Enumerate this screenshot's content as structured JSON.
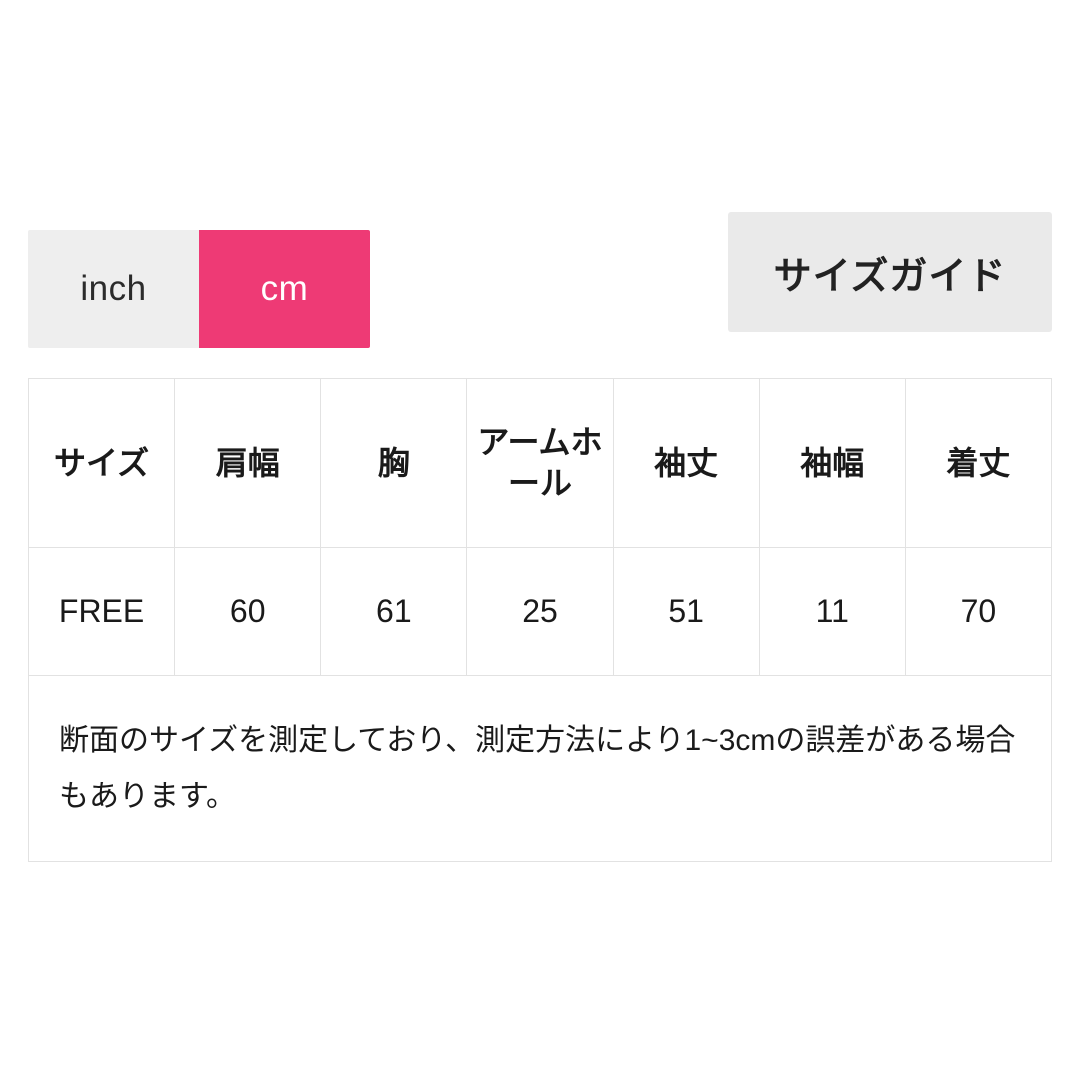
{
  "units": {
    "options": [
      {
        "label": "inch",
        "active": false
      },
      {
        "label": "cm",
        "active": true
      }
    ],
    "selected": "cm",
    "active_color": "#ee3a75",
    "inactive_color": "#eeeeee"
  },
  "guide": {
    "title": "サイズガイド",
    "background": "#eaeaea"
  },
  "table": {
    "columns": [
      "サイズ",
      "肩幅",
      "胸",
      "アームホール",
      "袖丈",
      "袖幅",
      "着丈"
    ],
    "rows": [
      {
        "size": "FREE",
        "values": [
          "60",
          "61",
          "25",
          "51",
          "11",
          "70"
        ]
      }
    ],
    "note": "断面のサイズを測定しており、測定方法により1~3cmの誤差がある場合もあります。",
    "border_color": "#e2e2e2"
  }
}
